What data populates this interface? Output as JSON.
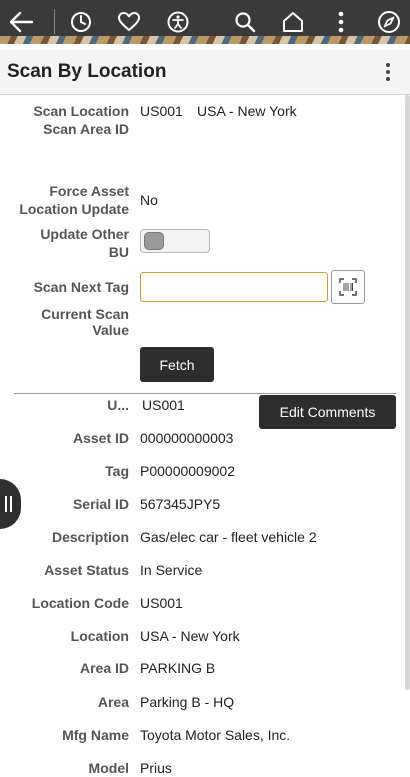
{
  "header": {
    "title": "Scan By Location",
    "icons": [
      "back-arrow-icon",
      "history-clock-icon",
      "heart-icon",
      "accessibility-icon",
      "search-icon",
      "home-icon",
      "more-vertical-icon",
      "compass-icon"
    ]
  },
  "scan": {
    "scan_location_label": "Scan Location",
    "scan_location_code": "US001",
    "scan_location_desc": "USA - New York",
    "scan_area_label": "Scan Area ID",
    "force_update_label_1": "Force Asset",
    "force_update_label_2": "Location Update",
    "force_update_value": "No",
    "update_other_bu_label_1": "Update Other",
    "update_other_bu_label_2": "BU",
    "scan_next_tag_label": "Scan Next Tag",
    "scan_next_tag_value": "",
    "current_scan_label_1": "Current Scan",
    "current_scan_label_2": "Value",
    "fetch_label": "Fetch"
  },
  "result": {
    "unit_label": "U...",
    "unit_value": "US001",
    "edit_comments_label": "Edit Comments",
    "fields": [
      {
        "label": "Asset ID",
        "value": "000000000003"
      },
      {
        "label": "Tag",
        "value": "P00000009002"
      },
      {
        "label": "Serial ID",
        "value": "567345JPY5"
      },
      {
        "label": "Description",
        "value": "Gas/elec car - fleet vehicle 2"
      },
      {
        "label": "Asset Status",
        "value": "In Service"
      },
      {
        "label": "Location Code",
        "value": "US001"
      },
      {
        "label": "Location",
        "value": "USA - New York"
      },
      {
        "label": "Area ID",
        "value": "PARKING B"
      },
      {
        "label": "Area",
        "value": "Parking B - HQ"
      },
      {
        "label": "Mfg Name",
        "value": "Toyota Motor Sales, Inc."
      },
      {
        "label": "Model",
        "value": "Prius"
      }
    ]
  }
}
